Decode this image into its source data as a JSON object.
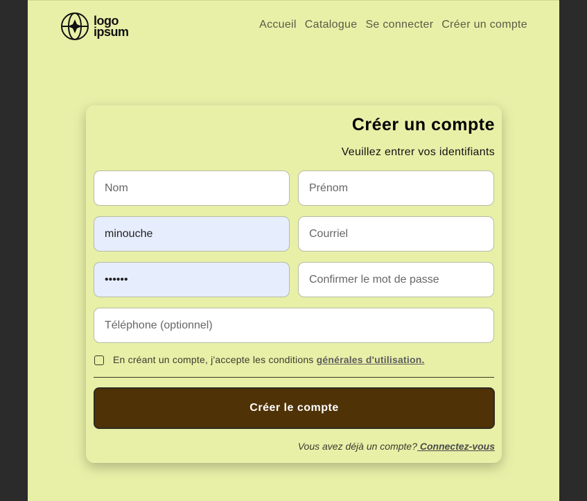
{
  "header": {
    "logo_top": "logo",
    "logo_bottom": "ipsum",
    "nav": [
      {
        "label": "Accueil"
      },
      {
        "label": "Catalogue"
      },
      {
        "label": "Se connecter"
      },
      {
        "label": "Créer un compte"
      }
    ]
  },
  "form": {
    "title": "Créer un compte",
    "subtitle": "Veuillez entrer vos identifiants",
    "fields": {
      "nom": {
        "placeholder": "Nom",
        "value": ""
      },
      "prenom": {
        "placeholder": "Prénom",
        "value": ""
      },
      "username": {
        "placeholder": "",
        "value": "minouche"
      },
      "courriel": {
        "placeholder": "Courriel",
        "value": ""
      },
      "password": {
        "placeholder": "",
        "value": "••••••"
      },
      "confirm": {
        "placeholder": "Confirmer le mot de passe",
        "value": ""
      },
      "telephone": {
        "placeholder": "Téléphone (optionnel)",
        "value": ""
      }
    },
    "terms": {
      "text": "En créant un compte, j'accepte les conditions ",
      "link": "générales d'utilisation."
    },
    "submit_label": "Créer le compte",
    "login_prompt": "Vous avez déjà un compte?",
    "login_link": " Connectez-vous"
  },
  "colors": {
    "background": "#e8f0a8",
    "button": "#4f3206",
    "autofill": "#e6edfc"
  }
}
